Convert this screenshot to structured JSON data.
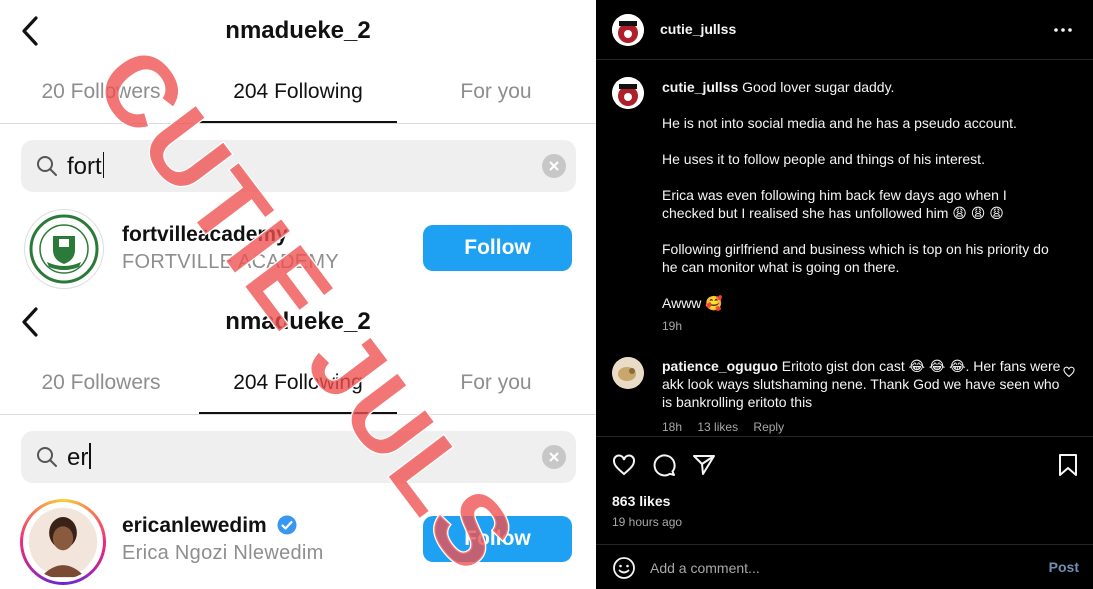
{
  "left": {
    "watermark": "CUTIE JULS",
    "screens": [
      {
        "title": "nmadueke_2",
        "tabs": [
          "20 Followers",
          "204 Following",
          "For you"
        ],
        "search_query": "fort",
        "result": {
          "username": "fortvilleacademy",
          "full_name": "FORTVILLE ACADEMY",
          "verified": false,
          "button": "Follow",
          "avatar_icon": "school-crest-icon"
        }
      },
      {
        "title": "nmadueke_2",
        "tabs": [
          "20 Followers",
          "204 Following",
          "For you"
        ],
        "search_query": "er",
        "result": {
          "username": "ericanlewedim",
          "full_name": "Erica Ngozi Nlewedim",
          "verified": true,
          "button": "Follow",
          "avatar_icon": "profile-photo"
        }
      }
    ]
  },
  "post": {
    "author": "cutie_jullss",
    "caption_author": "cutie_jullss",
    "caption_lines": [
      "Good lover sugar daddy.",
      "He is not into social media and he has a pseudo account.",
      "He uses it to follow people and things of his interest.",
      "Erica was even following him back few days ago when I checked but I realised she has unfollowed him 😩 😩 😩",
      "Following girlfriend and business which is top on his priority do he can monitor what is going on there.",
      "Awww 🥰"
    ],
    "caption_time": "19h",
    "comment": {
      "author": "patience_oguguo",
      "text": "Eritoto gist don cast 😂 😂 😂. Her fans were akk look ways slutshaming nene. Thank God we have seen who is bankrolling eritoto this",
      "time": "18h",
      "likes": "13 likes",
      "reply": "Reply"
    },
    "likes": "863 likes",
    "posted_ago": "19 hours ago",
    "comment_placeholder": "Add a comment...",
    "post_button": "Post",
    "colors": {
      "follow_blue": "#1ea1f3",
      "watermark_red": "#f05050",
      "post_link": "#6f8fb5"
    }
  }
}
